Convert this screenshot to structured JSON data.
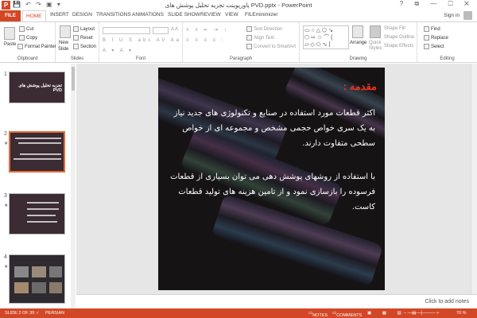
{
  "window": {
    "title": "پاورپوینت تجزیه تحلیل پوشش های PVD.pptx - PowerPoint",
    "app_letter": "P",
    "sign_in": "Sign in",
    "controls": "? ⧉ — ☐ ✕"
  },
  "tabs": [
    "FILE",
    "HOME",
    "INSERT",
    "DESIGN",
    "TRANSITIONS",
    "ANIMATIONS",
    "SLIDE SHOW",
    "REVIEW",
    "VIEW",
    "FILEminimizer"
  ],
  "ribbon": {
    "clipboard": {
      "paste": "Paste",
      "cut": "Cut",
      "copy": "Copy",
      "format_painter": "Format Painter",
      "label": "Clipboard"
    },
    "slides": {
      "new_slide": "New",
      "new_slide2": "Slide",
      "layout": "Layout",
      "reset": "Reset",
      "section": "Section",
      "label": "Slides"
    },
    "font": {
      "label": "Font"
    },
    "paragraph": {
      "text_direction": "Text Direction",
      "align_text": "Align Text",
      "convert": "Convert to SmartArt",
      "label": "Paragraph"
    },
    "drawing": {
      "arrange": "Arrange",
      "quick_styles": "Quick",
      "quick_styles2": "Styles",
      "shape_fill": "Shape Fill",
      "shape_outline": "Shape Outline",
      "shape_effects": "Shape Effects",
      "label": "Drawing"
    },
    "editing": {
      "find": "Find",
      "replace": "Replace",
      "select": "Select",
      "label": "Editing"
    }
  },
  "thumbnails": [
    {
      "num": "1",
      "title": "تجزیه تحلیل پوشش های PVD"
    },
    {
      "num": "2"
    },
    {
      "num": "3"
    },
    {
      "num": "4"
    }
  ],
  "slide": {
    "heading": "مقدمه :",
    "paragraph1": "اکثر قطعات مورد استفاده در صنایع و تکنولوژی های جدید نیاز به یک سری خواص حجمی مشخص و مجموعه ای از خواص سطحی متفاوت دارند.",
    "paragraph2": "با استفاده از روشهای پوشش دهی می توان بسیاری از قطعات فرسوده را بازسازی نمود و از تامین هزینه های تولید قطعات کاست."
  },
  "notes_placeholder": "Click to add notes",
  "status": {
    "slide_count": "SLIDE 2 OF 39",
    "language": "PERSIAN",
    "notes": "NOTES",
    "comments": "COMMENTS",
    "zoom": "70 %"
  },
  "colors": {
    "accent": "#d24726",
    "slide_heading": "#e8321e",
    "selected_thumb": "#e36c3a"
  }
}
